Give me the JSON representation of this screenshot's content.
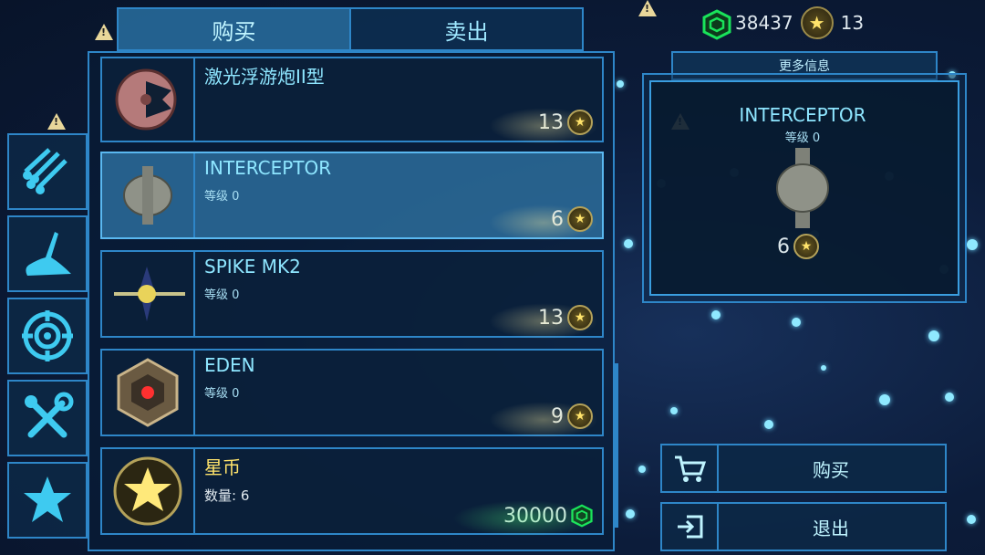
{
  "tabs": [
    {
      "label": "购买",
      "active": true
    },
    {
      "label": "卖出",
      "active": false
    }
  ],
  "currency": {
    "cubes": "38437",
    "stars": "13",
    "cube_icon": "green-cube-icon",
    "star_icon": "star-coin-icon"
  },
  "sidebar": [
    {
      "icon": "missiles-icon"
    },
    {
      "icon": "ship-wing-icon"
    },
    {
      "icon": "crosshair-icon"
    },
    {
      "icon": "tools-icon"
    },
    {
      "icon": "star-icon"
    }
  ],
  "items": [
    {
      "name": "激光浮游炮II型",
      "level": "",
      "price": "13",
      "currency": "star"
    },
    {
      "name": "INTERCEPTOR",
      "level": "等级 0",
      "price": "6",
      "currency": "star",
      "selected": true
    },
    {
      "name": "SPIKE MK2",
      "level": "等级 0",
      "price": "13",
      "currency": "star"
    },
    {
      "name": "EDEN",
      "level": "等级 0",
      "price": "9",
      "currency": "star"
    },
    {
      "name": "星币",
      "level": "数量: 6",
      "price": "30000",
      "currency": "cube"
    }
  ],
  "info": {
    "header": "更多信息",
    "title": "INTERCEPTOR",
    "level": "等级 0",
    "price": "6"
  },
  "actions": {
    "buy_label": "购买",
    "exit_label": "退出"
  },
  "colors": {
    "frame": "#2e86c8",
    "text_accent": "#8ee6ff",
    "star_gold": "#ffe36b",
    "cube_green": "#19e35a"
  }
}
